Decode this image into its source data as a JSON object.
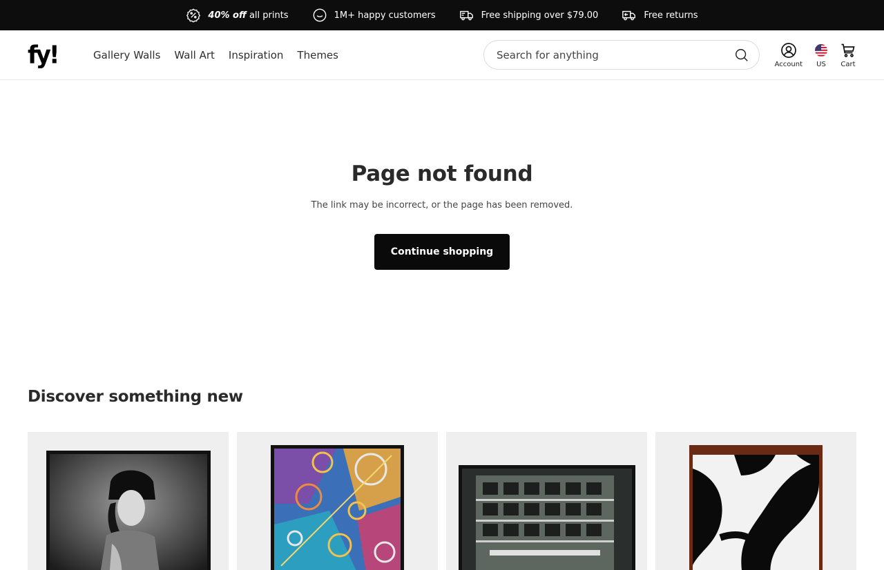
{
  "topbar": {
    "perks": [
      {
        "icon": "percent-badge-icon",
        "bold": "40% off",
        "text": " all prints"
      },
      {
        "icon": "smiley-icon",
        "text": "1M+ happy customers"
      },
      {
        "icon": "truck-icon",
        "text": "Free shipping over $79.00"
      },
      {
        "icon": "return-truck-icon",
        "text": "Free returns"
      }
    ]
  },
  "header": {
    "logo": "fy!",
    "nav": [
      "Gallery Walls",
      "Wall Art",
      "Inspiration",
      "Themes"
    ],
    "search_placeholder": "Search for anything",
    "account_label": "Account",
    "region_label": "US",
    "cart_label": "Cart"
  },
  "main": {
    "title": "Page not found",
    "message": "The link may be incorrect, or the page has been removed.",
    "cta": "Continue shopping"
  },
  "discover": {
    "title": "Discover something new",
    "products": [
      {
        "name": "black-white-portrait-print"
      },
      {
        "name": "abstract-gears-print"
      },
      {
        "name": "city-building-print"
      },
      {
        "name": "abstract-black-white-shapes-print"
      }
    ]
  },
  "colors": {
    "topbar_bg": "#0d0d0d",
    "button_bg": "#0a0a0a",
    "text": "#2b2b2b"
  }
}
